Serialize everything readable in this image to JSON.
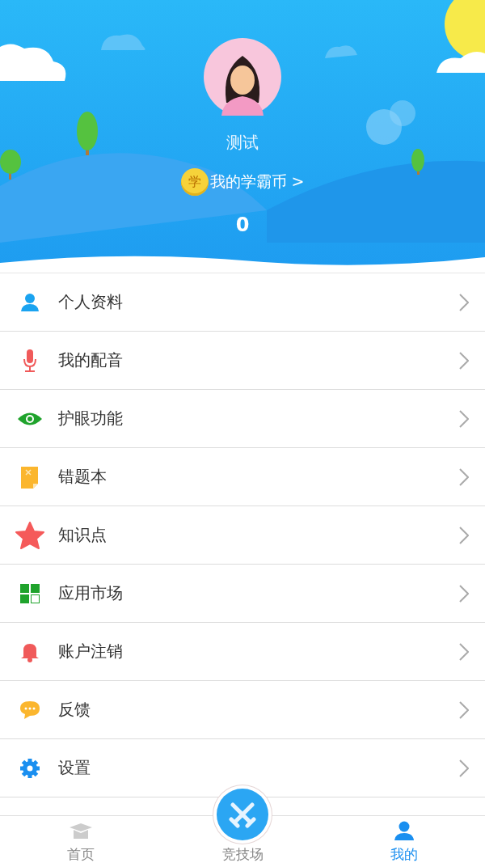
{
  "profile": {
    "name": "测试",
    "coin_mark": "学",
    "coin_link": "我的学霸币 >",
    "coins": "0"
  },
  "menu": [
    {
      "kind": "person",
      "label": "个人资料"
    },
    {
      "kind": "mic",
      "label": "我的配音"
    },
    {
      "kind": "eye",
      "label": "护眼功能"
    },
    {
      "kind": "notebook",
      "label": "错题本"
    },
    {
      "kind": "star",
      "label": "知识点"
    },
    {
      "kind": "grid",
      "label": "应用市场"
    },
    {
      "kind": "bell",
      "label": "账户注销"
    },
    {
      "kind": "chat",
      "label": "反馈"
    },
    {
      "kind": "gear",
      "label": "设置"
    }
  ],
  "tabs": [
    {
      "kind": "home",
      "label": "首页",
      "selected": false
    },
    {
      "kind": "center",
      "label": "竞技场",
      "selected": false
    },
    {
      "kind": "me",
      "label": "我的",
      "selected": true
    }
  ]
}
